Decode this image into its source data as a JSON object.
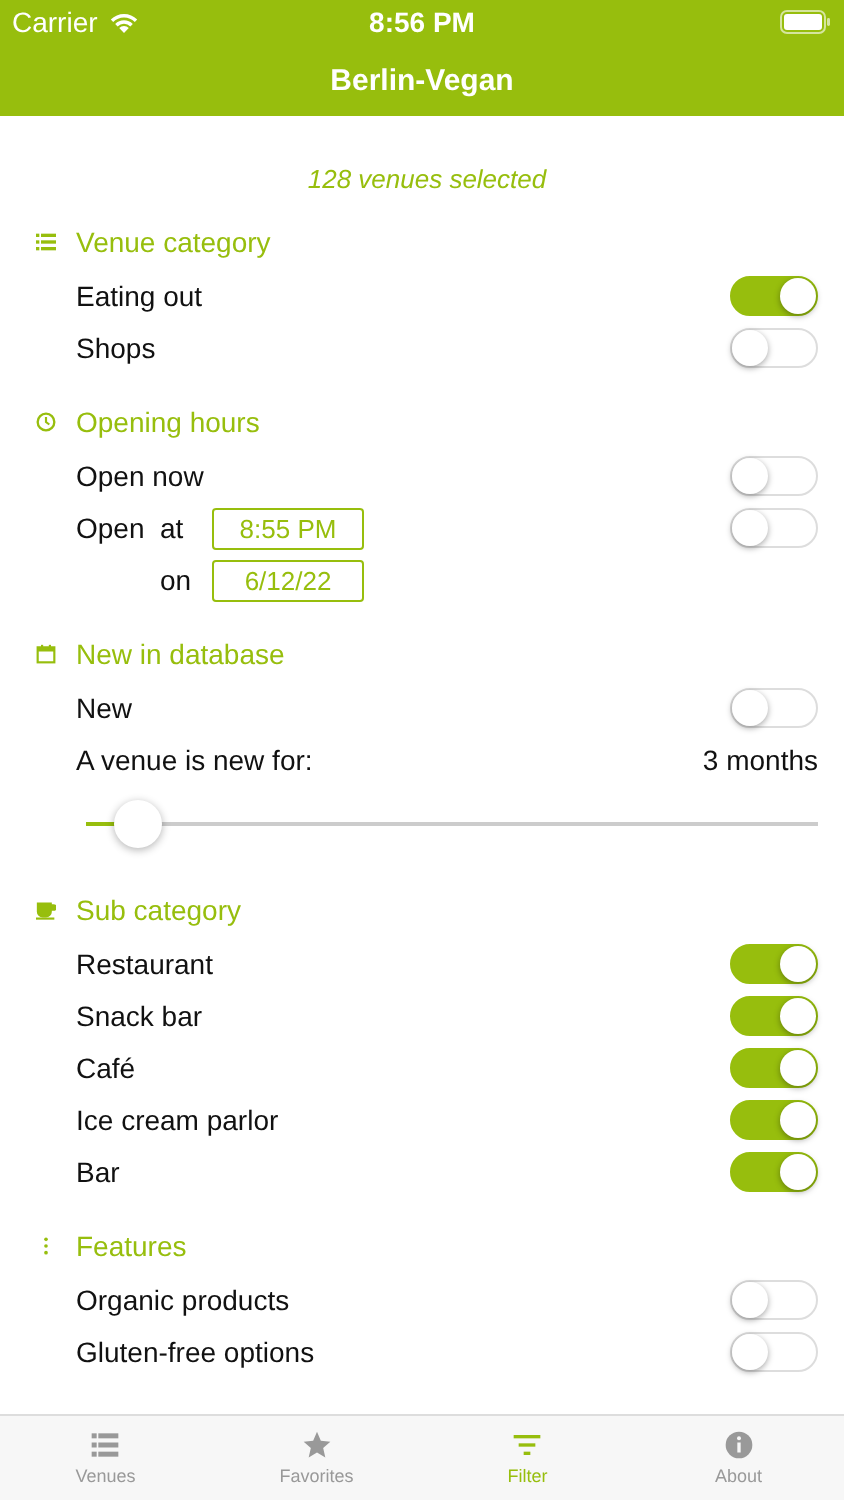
{
  "status_bar": {
    "carrier": "Carrier",
    "time": "8:56 PM"
  },
  "nav": {
    "title": "Berlin-Vegan"
  },
  "summary": "128 venues selected",
  "sections": [
    {
      "title": "Venue category",
      "kind": "list",
      "rows": [
        {
          "kind": "toggle",
          "label": "Eating out",
          "on": true
        },
        {
          "kind": "toggle",
          "label": "Shops",
          "on": false
        }
      ]
    },
    {
      "title": "Opening hours",
      "kind": "clock",
      "rows": [
        {
          "kind": "toggle",
          "label": "Open now",
          "on": false
        },
        {
          "kind": "datetime",
          "label": "Open",
          "at_label": "at",
          "time": "8:55 PM",
          "on_label": "on",
          "date": "6/12/22",
          "on": false
        }
      ]
    },
    {
      "title": "New in database",
      "kind": "calendar",
      "rows": [
        {
          "kind": "toggle",
          "label": "New",
          "on": false
        },
        {
          "kind": "value",
          "label": "A venue is new for:",
          "value": "3 months"
        },
        {
          "kind": "slider",
          "level": 0.07
        }
      ]
    },
    {
      "title": "Sub category",
      "kind": "cup",
      "rows": [
        {
          "kind": "toggle",
          "label": "Restaurant",
          "on": true
        },
        {
          "kind": "toggle",
          "label": "Snack bar",
          "on": true
        },
        {
          "kind": "toggle",
          "label": "Café",
          "on": true
        },
        {
          "kind": "toggle",
          "label": "Ice cream parlor",
          "on": true
        },
        {
          "kind": "toggle",
          "label": "Bar",
          "on": true
        }
      ]
    },
    {
      "title": "Features",
      "kind": "dots",
      "rows": [
        {
          "kind": "toggle",
          "label": "Organic products",
          "on": false
        },
        {
          "kind": "toggle",
          "label": "Gluten-free options",
          "on": false
        }
      ]
    }
  ],
  "tabs": [
    {
      "label": "Venues",
      "kind": "list",
      "selected": false
    },
    {
      "label": "Favorites",
      "kind": "star",
      "selected": false
    },
    {
      "label": "Filter",
      "kind": "filter",
      "selected": true
    },
    {
      "label": "About",
      "kind": "info",
      "selected": false
    }
  ]
}
